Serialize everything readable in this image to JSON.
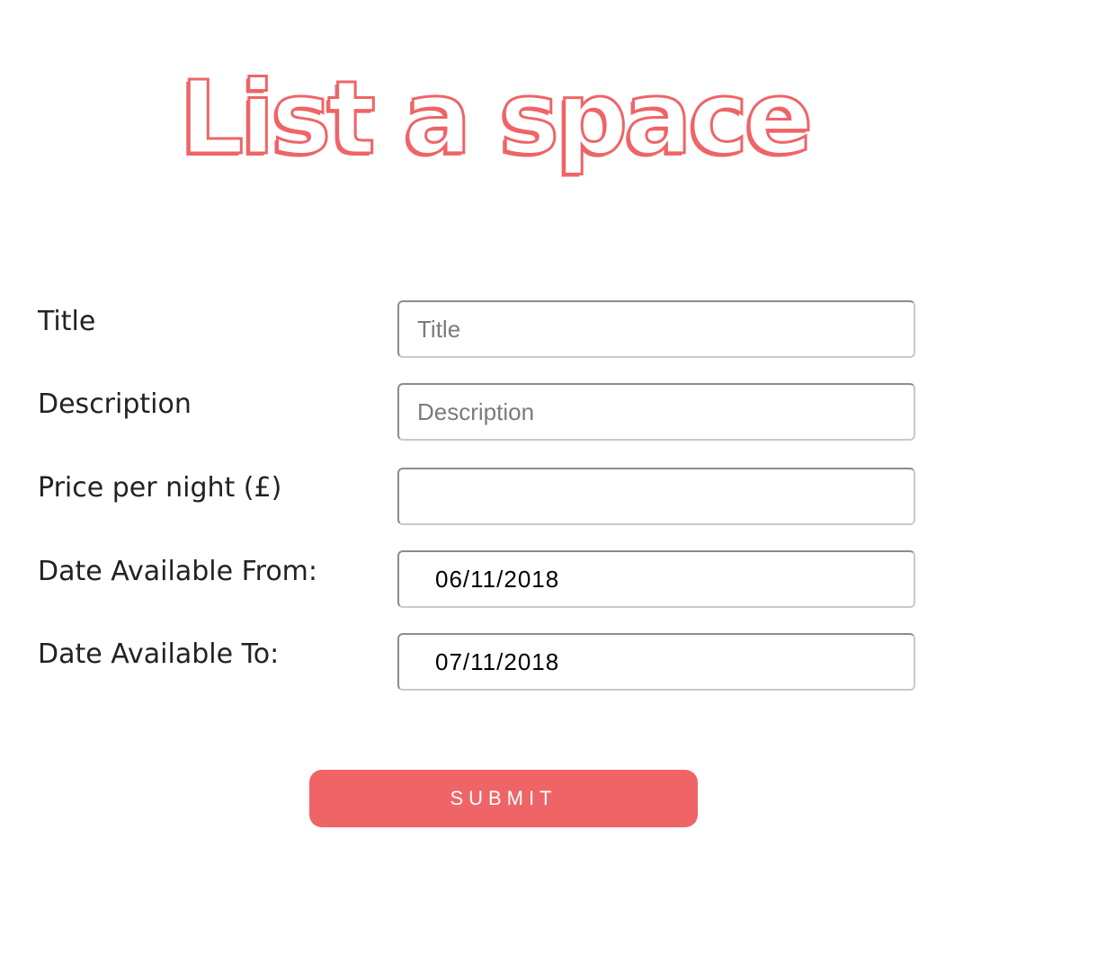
{
  "page": {
    "title": "List a space"
  },
  "form": {
    "fields": [
      {
        "label": "Title",
        "placeholder": "Title",
        "value": ""
      },
      {
        "label": "Description",
        "placeholder": "Description",
        "value": ""
      },
      {
        "label": "Price per night (£)",
        "placeholder": "",
        "value": ""
      },
      {
        "label": "Date Available From:",
        "placeholder": "",
        "value": "06/11/2018"
      },
      {
        "label": "Date Available To:",
        "placeholder": "",
        "value": "07/11/2018"
      }
    ],
    "submit_label": "SUBMIT"
  },
  "colors": {
    "accent": "#ef6467",
    "label_text": "#222222",
    "placeholder_text": "#7b7b7b"
  }
}
